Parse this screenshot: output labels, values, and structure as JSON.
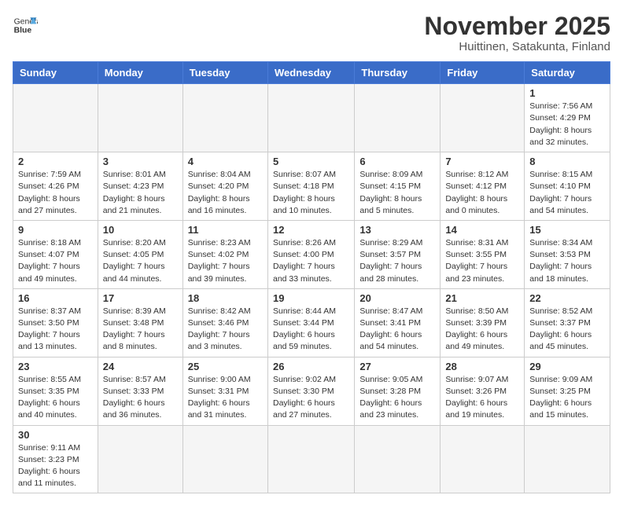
{
  "header": {
    "logo_text_regular": "General",
    "logo_text_bold": "Blue",
    "month_title": "November 2025",
    "location": "Huittinen, Satakunta, Finland"
  },
  "weekdays": [
    "Sunday",
    "Monday",
    "Tuesday",
    "Wednesday",
    "Thursday",
    "Friday",
    "Saturday"
  ],
  "weeks": [
    [
      {
        "day": null,
        "info": null
      },
      {
        "day": null,
        "info": null
      },
      {
        "day": null,
        "info": null
      },
      {
        "day": null,
        "info": null
      },
      {
        "day": null,
        "info": null
      },
      {
        "day": null,
        "info": null
      },
      {
        "day": "1",
        "info": "Sunrise: 7:56 AM\nSunset: 4:29 PM\nDaylight: 8 hours\nand 32 minutes."
      }
    ],
    [
      {
        "day": "2",
        "info": "Sunrise: 7:59 AM\nSunset: 4:26 PM\nDaylight: 8 hours\nand 27 minutes."
      },
      {
        "day": "3",
        "info": "Sunrise: 8:01 AM\nSunset: 4:23 PM\nDaylight: 8 hours\nand 21 minutes."
      },
      {
        "day": "4",
        "info": "Sunrise: 8:04 AM\nSunset: 4:20 PM\nDaylight: 8 hours\nand 16 minutes."
      },
      {
        "day": "5",
        "info": "Sunrise: 8:07 AM\nSunset: 4:18 PM\nDaylight: 8 hours\nand 10 minutes."
      },
      {
        "day": "6",
        "info": "Sunrise: 8:09 AM\nSunset: 4:15 PM\nDaylight: 8 hours\nand 5 minutes."
      },
      {
        "day": "7",
        "info": "Sunrise: 8:12 AM\nSunset: 4:12 PM\nDaylight: 8 hours\nand 0 minutes."
      },
      {
        "day": "8",
        "info": "Sunrise: 8:15 AM\nSunset: 4:10 PM\nDaylight: 7 hours\nand 54 minutes."
      }
    ],
    [
      {
        "day": "9",
        "info": "Sunrise: 8:18 AM\nSunset: 4:07 PM\nDaylight: 7 hours\nand 49 minutes."
      },
      {
        "day": "10",
        "info": "Sunrise: 8:20 AM\nSunset: 4:05 PM\nDaylight: 7 hours\nand 44 minutes."
      },
      {
        "day": "11",
        "info": "Sunrise: 8:23 AM\nSunset: 4:02 PM\nDaylight: 7 hours\nand 39 minutes."
      },
      {
        "day": "12",
        "info": "Sunrise: 8:26 AM\nSunset: 4:00 PM\nDaylight: 7 hours\nand 33 minutes."
      },
      {
        "day": "13",
        "info": "Sunrise: 8:29 AM\nSunset: 3:57 PM\nDaylight: 7 hours\nand 28 minutes."
      },
      {
        "day": "14",
        "info": "Sunrise: 8:31 AM\nSunset: 3:55 PM\nDaylight: 7 hours\nand 23 minutes."
      },
      {
        "day": "15",
        "info": "Sunrise: 8:34 AM\nSunset: 3:53 PM\nDaylight: 7 hours\nand 18 minutes."
      }
    ],
    [
      {
        "day": "16",
        "info": "Sunrise: 8:37 AM\nSunset: 3:50 PM\nDaylight: 7 hours\nand 13 minutes."
      },
      {
        "day": "17",
        "info": "Sunrise: 8:39 AM\nSunset: 3:48 PM\nDaylight: 7 hours\nand 8 minutes."
      },
      {
        "day": "18",
        "info": "Sunrise: 8:42 AM\nSunset: 3:46 PM\nDaylight: 7 hours\nand 3 minutes."
      },
      {
        "day": "19",
        "info": "Sunrise: 8:44 AM\nSunset: 3:44 PM\nDaylight: 6 hours\nand 59 minutes."
      },
      {
        "day": "20",
        "info": "Sunrise: 8:47 AM\nSunset: 3:41 PM\nDaylight: 6 hours\nand 54 minutes."
      },
      {
        "day": "21",
        "info": "Sunrise: 8:50 AM\nSunset: 3:39 PM\nDaylight: 6 hours\nand 49 minutes."
      },
      {
        "day": "22",
        "info": "Sunrise: 8:52 AM\nSunset: 3:37 PM\nDaylight: 6 hours\nand 45 minutes."
      }
    ],
    [
      {
        "day": "23",
        "info": "Sunrise: 8:55 AM\nSunset: 3:35 PM\nDaylight: 6 hours\nand 40 minutes."
      },
      {
        "day": "24",
        "info": "Sunrise: 8:57 AM\nSunset: 3:33 PM\nDaylight: 6 hours\nand 36 minutes."
      },
      {
        "day": "25",
        "info": "Sunrise: 9:00 AM\nSunset: 3:31 PM\nDaylight: 6 hours\nand 31 minutes."
      },
      {
        "day": "26",
        "info": "Sunrise: 9:02 AM\nSunset: 3:30 PM\nDaylight: 6 hours\nand 27 minutes."
      },
      {
        "day": "27",
        "info": "Sunrise: 9:05 AM\nSunset: 3:28 PM\nDaylight: 6 hours\nand 23 minutes."
      },
      {
        "day": "28",
        "info": "Sunrise: 9:07 AM\nSunset: 3:26 PM\nDaylight: 6 hours\nand 19 minutes."
      },
      {
        "day": "29",
        "info": "Sunrise: 9:09 AM\nSunset: 3:25 PM\nDaylight: 6 hours\nand 15 minutes."
      }
    ],
    [
      {
        "day": "30",
        "info": "Sunrise: 9:11 AM\nSunset: 3:23 PM\nDaylight: 6 hours\nand 11 minutes."
      },
      {
        "day": null,
        "info": null
      },
      {
        "day": null,
        "info": null
      },
      {
        "day": null,
        "info": null
      },
      {
        "day": null,
        "info": null
      },
      {
        "day": null,
        "info": null
      },
      {
        "day": null,
        "info": null
      }
    ]
  ]
}
